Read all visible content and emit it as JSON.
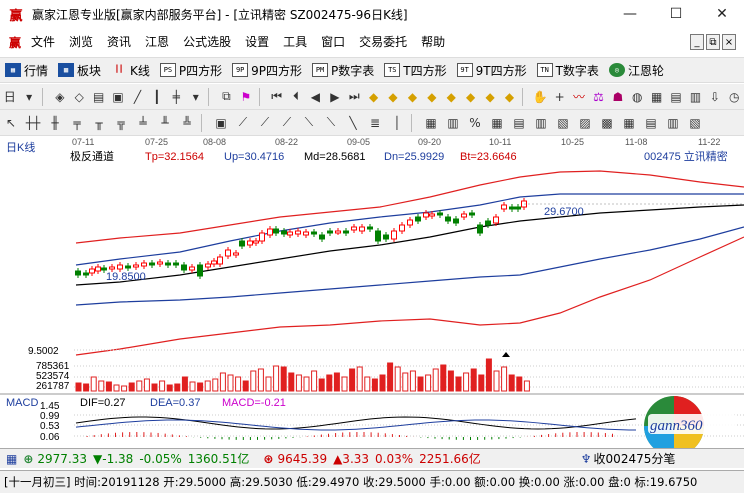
{
  "window": {
    "title": "赢家江恩专业版[赢家内部服务平台] - [立讯精密  SZ002475-96日K线]",
    "controls": [
      "—",
      "☐",
      "✕"
    ]
  },
  "menu": {
    "items": [
      "文件",
      "浏览",
      "资讯",
      "江恩",
      "公式选股",
      "设置",
      "工具",
      "窗口",
      "交易委托",
      "帮助"
    ],
    "mdi_controls": [
      "_",
      "⧉",
      "×"
    ]
  },
  "toolbar1": {
    "items": [
      {
        "label": "行情",
        "icon": "grid-icon"
      },
      {
        "label": "板块",
        "icon": "blocks-icon"
      },
      {
        "label": "K线",
        "icon": "kline-icon"
      },
      {
        "label": "P四方形",
        "icon": "ps-icon"
      },
      {
        "label": "9P四方形",
        "icon": "9p-icon"
      },
      {
        "label": "P数字表",
        "icon": "pm-icon"
      },
      {
        "label": "T四方形",
        "icon": "ts-icon"
      },
      {
        "label": "9T四方形",
        "icon": "9t-icon"
      },
      {
        "label": "T数字表",
        "icon": "tn-icon"
      },
      {
        "label": "江恩轮",
        "icon": "wheel-icon"
      }
    ]
  },
  "chart_header": {
    "period_label": "日K线",
    "dates": [
      "07-11",
      "07-25",
      "08-08",
      "08-22",
      "09-05",
      "09-20",
      "10-11",
      "10-25",
      "11-08",
      "11-22"
    ],
    "indicator_name": "极反通道",
    "tp": "Tp=32.1564",
    "up": "Up=30.4716",
    "md": "Md=28.5681",
    "dn": "Dn=25.9929",
    "bt": "Bt=23.6646",
    "stock": "002475  立讯精密"
  },
  "chart_data": {
    "type": "line",
    "price_low_label": "19.8500",
    "price_high_label": "29.6700",
    "y_label_left": "9.5002",
    "volume_labels": [
      "785361",
      "523574",
      "261787"
    ],
    "macd": {
      "name": "MACD",
      "dif": "DIF=0.27",
      "dea": "DEA=0.37",
      "macd": "MACD=-0.21",
      "ticks": [
        "1.45",
        "0.99",
        "0.53",
        "0.06"
      ]
    }
  },
  "status1": {
    "sh_index": "2977.33",
    "sh_change": "▼-1.38",
    "sh_pct": "-0.05%",
    "sh_amount": "1360.51亿",
    "sz_index": "9645.39",
    "sz_change": "▲3.33",
    "sz_pct": "0.03%",
    "sz_amount": "2251.66亿",
    "ticker_text": "收002475分笔"
  },
  "status2": {
    "text": "[十一月初三] 时间:20191128 开:29.5000 高:29.5030 低:29.4970 收:29.5000 手:0.00 额:0.00 换:0.00 涨:0.00 盘:0 标:19.6750"
  },
  "logo": {
    "text": "gann360"
  },
  "colors": {
    "up": "#ff0000",
    "down": "#008000",
    "bg": "#ffffff",
    "header_text": "#1e3e9e"
  }
}
